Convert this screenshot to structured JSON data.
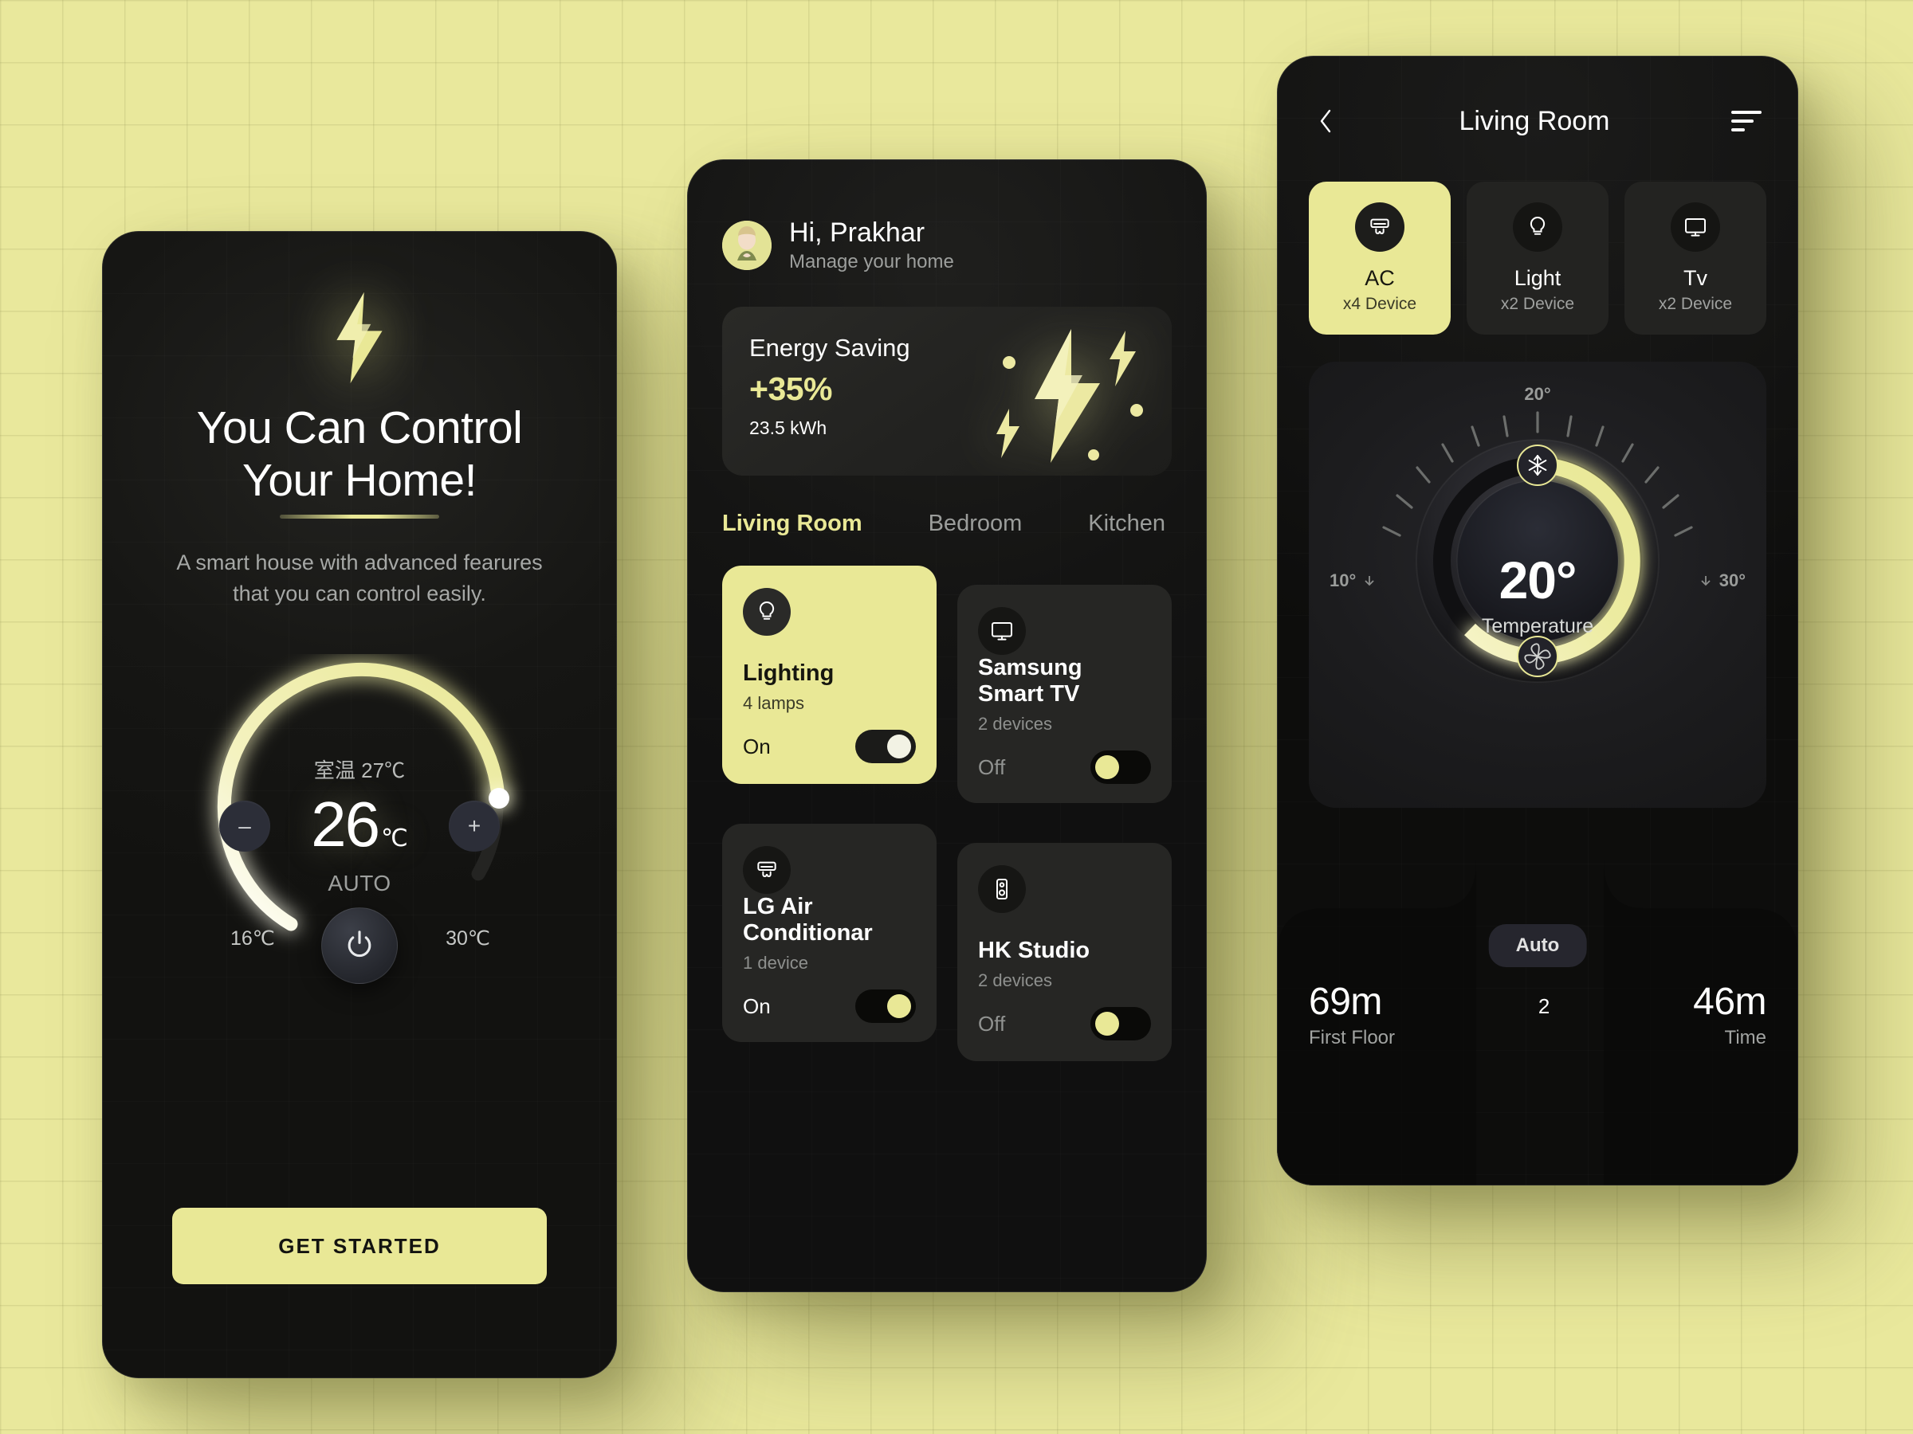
{
  "theme": {
    "accent": "#e9e896",
    "background": "#e9e89c",
    "phone_bg": "#161614",
    "card_dark": "#262624",
    "text_primary": "#ffffff",
    "text_muted": "#9d9f9d"
  },
  "onboarding": {
    "hero_icon": "lightning-bolt-icon",
    "title_line1": "You Can Control",
    "title_line2": "Your Home!",
    "subtitle_line1": "A smart house with advanced fearures",
    "subtitle_line2": "that you can control easily.",
    "dial": {
      "room_temp_label": "室温 27℃",
      "value": "26",
      "unit": "℃",
      "mode": "AUTO",
      "range_min": "16℃",
      "range_max": "30℃",
      "minus_label": "–",
      "plus_label": "+",
      "power_icon": "power-icon",
      "arc_percent": 72
    },
    "cta_label": "GET STARTED"
  },
  "home": {
    "greeting": "Hi, Prakhar",
    "greeting_sub": "Manage your home",
    "avatar_icon": "user-avatar",
    "energy": {
      "title": "Energy Saving",
      "percent": "+35%",
      "kwh": "23.5 kWh",
      "art_icon": "lightning-bolt-icon"
    },
    "tabs": [
      {
        "label": "Living Room",
        "active": true
      },
      {
        "label": "Bedroom",
        "active": false
      },
      {
        "label": "Kitchen",
        "active": false
      }
    ],
    "devices": [
      {
        "name": "Lighting",
        "count": "4 lamps",
        "state": "On",
        "icon": "lightbulb-icon",
        "active": true
      },
      {
        "name": "Samsung Smart TV",
        "count": "2 devices",
        "state": "Off",
        "icon": "tv-icon",
        "active": false
      },
      {
        "name": "LG Air Conditionar",
        "count": "1 device",
        "state": "On",
        "icon": "air-conditioner-icon",
        "active": false
      },
      {
        "name": "HK Studio",
        "count": "2 devices",
        "state": "Off",
        "icon": "speaker-icon",
        "active": false
      }
    ]
  },
  "room": {
    "back_icon": "chevron-left-icon",
    "title": "Living Room",
    "menu_icon": "menu-icon",
    "chips": [
      {
        "name": "AC",
        "count": "x4 Device",
        "icon": "air-conditioner-icon",
        "active": true
      },
      {
        "name": "Light",
        "count": "x2 Device",
        "icon": "lightbulb-icon",
        "active": false
      },
      {
        "name": "Tv",
        "count": "x2 Device",
        "icon": "tv-icon",
        "active": false
      }
    ],
    "thermostat": {
      "tick_top": "20°",
      "tick_left": "10°",
      "tick_right": "30°",
      "value": "20°",
      "label": "Temperature",
      "cool_icon": "snowflake-icon",
      "fan_icon": "fan-icon"
    },
    "mode_pill": "Auto",
    "stats": {
      "left_value": "69m",
      "left_label": "First Floor",
      "middle_value": "2",
      "right_value": "46m",
      "right_label": "Time"
    }
  }
}
